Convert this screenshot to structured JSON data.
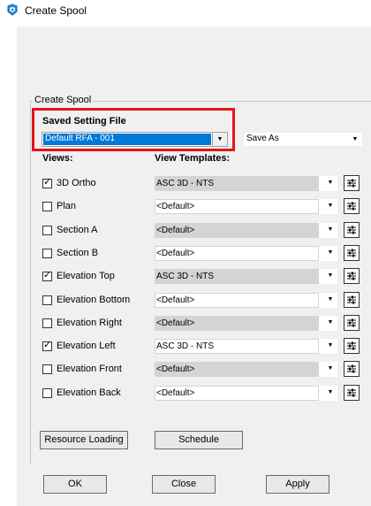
{
  "window": {
    "title": "Create Spool"
  },
  "group": {
    "label": "Create Spool"
  },
  "saved_setting": {
    "label": "Saved Setting File",
    "value": "Default RFA - 001",
    "save_as_value": "Save As"
  },
  "headers": {
    "views": "Views:",
    "templates": "View Templates:"
  },
  "rows": [
    {
      "view": "3D Ortho",
      "checked": true,
      "template": "ASC 3D - NTS",
      "gray": true
    },
    {
      "view": "Plan",
      "checked": false,
      "template": "<Default>",
      "gray": false
    },
    {
      "view": "Section A",
      "checked": false,
      "template": "<Default>",
      "gray": true
    },
    {
      "view": "Section B",
      "checked": false,
      "template": "<Default>",
      "gray": false
    },
    {
      "view": "Elevation Top",
      "checked": true,
      "template": "ASC 3D - NTS",
      "gray": true
    },
    {
      "view": "Elevation Bottom",
      "checked": false,
      "template": "<Default>",
      "gray": false
    },
    {
      "view": "Elevation Right",
      "checked": false,
      "template": "<Default>",
      "gray": true
    },
    {
      "view": "Elevation Left",
      "checked": true,
      "template": "ASC 3D - NTS",
      "gray": false
    },
    {
      "view": "Elevation Front",
      "checked": false,
      "template": "<Default>",
      "gray": true
    },
    {
      "view": "Elevation Back",
      "checked": false,
      "template": "<Default>",
      "gray": false
    }
  ],
  "buttons": {
    "resource_loading": "Resource Loading",
    "schedule": "Schedule",
    "ok": "OK",
    "close": "Close",
    "apply": "Apply"
  },
  "colors": {
    "highlight": "#e3151b",
    "selection": "#0078d7",
    "dialog_bg": "#f0f0f0",
    "disabled_field": "#d4d4d4"
  },
  "icons": {
    "app": "spool-app-icon",
    "row_settings": "settings-sliders-icon",
    "dropdown": "chevron-down-icon"
  }
}
